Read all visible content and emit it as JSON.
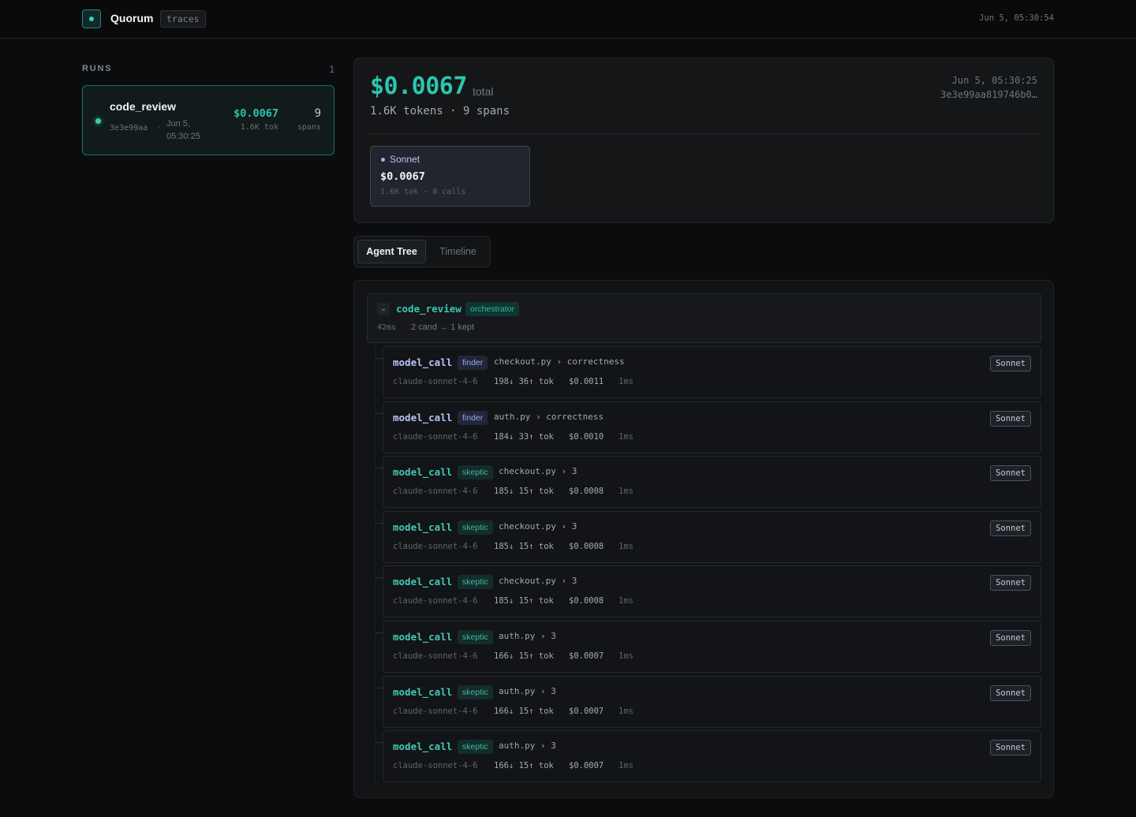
{
  "header": {
    "app_title": "Quorum",
    "app_badge": "traces",
    "clock": "Jun 5, 05:30:54"
  },
  "sidebar": {
    "title": "RUNS",
    "count": "1",
    "runs": [
      {
        "name": "code_review",
        "id": "3e3e99aa",
        "separator": "·",
        "date": "Jun 5, 05:30:25",
        "cost": "$0.0067",
        "tokens": "1.6K tok",
        "spans": "9",
        "spans_label": "spans",
        "status_color": "#3ad29c"
      }
    ]
  },
  "summary": {
    "total": "$0.0067",
    "total_label": "total",
    "subtitle": "1.6K tokens · 9 spans",
    "date": "Jun 5, 05:30:25",
    "hash": "3e3e99aa819746b0…",
    "models": [
      {
        "name": "Sonnet",
        "cost": "$0.0067",
        "meta": "1.6K tok · 8 calls"
      }
    ]
  },
  "tabs": [
    {
      "label": "Agent Tree",
      "active": true
    },
    {
      "label": "Timeline",
      "active": false
    }
  ],
  "tree": {
    "root": {
      "chevron": "⌄",
      "name": "code_review",
      "role": "orchestrator",
      "duration": "42ms",
      "note": "2 cand → 1 kept"
    },
    "children": [
      {
        "name": "model_call",
        "role": "finder",
        "path": "checkout.py › correctness",
        "model": "claude-sonnet-4-6",
        "tokens": "198↓ 36↑ tok",
        "cost": "$0.0011",
        "duration": "1ms",
        "badge": "Sonnet"
      },
      {
        "name": "model_call",
        "role": "finder",
        "path": "auth.py › correctness",
        "model": "claude-sonnet-4-6",
        "tokens": "184↓ 33↑ tok",
        "cost": "$0.0010",
        "duration": "1ms",
        "badge": "Sonnet"
      },
      {
        "name": "model_call",
        "role": "skeptic",
        "path": "checkout.py › 3",
        "model": "claude-sonnet-4-6",
        "tokens": "185↓ 15↑ tok",
        "cost": "$0.0008",
        "duration": "1ms",
        "badge": "Sonnet"
      },
      {
        "name": "model_call",
        "role": "skeptic",
        "path": "checkout.py › 3",
        "model": "claude-sonnet-4-6",
        "tokens": "185↓ 15↑ tok",
        "cost": "$0.0008",
        "duration": "1ms",
        "badge": "Sonnet"
      },
      {
        "name": "model_call",
        "role": "skeptic",
        "path": "checkout.py › 3",
        "model": "claude-sonnet-4-6",
        "tokens": "185↓ 15↑ tok",
        "cost": "$0.0008",
        "duration": "1ms",
        "badge": "Sonnet"
      },
      {
        "name": "model_call",
        "role": "skeptic",
        "path": "auth.py › 3",
        "model": "claude-sonnet-4-6",
        "tokens": "166↓ 15↑ tok",
        "cost": "$0.0007",
        "duration": "1ms",
        "badge": "Sonnet"
      },
      {
        "name": "model_call",
        "role": "skeptic",
        "path": "auth.py › 3",
        "model": "claude-sonnet-4-6",
        "tokens": "166↓ 15↑ tok",
        "cost": "$0.0007",
        "duration": "1ms",
        "badge": "Sonnet"
      },
      {
        "name": "model_call",
        "role": "skeptic",
        "path": "auth.py › 3",
        "model": "claude-sonnet-4-6",
        "tokens": "166↓ 15↑ tok",
        "cost": "$0.0007",
        "duration": "1ms",
        "badge": "Sonnet"
      }
    ]
  },
  "colors": {
    "accent": "#2cc5ae",
    "finder": "#b8c3f8",
    "skeptic": "#44c8b4",
    "background": "#0b0c0d"
  }
}
